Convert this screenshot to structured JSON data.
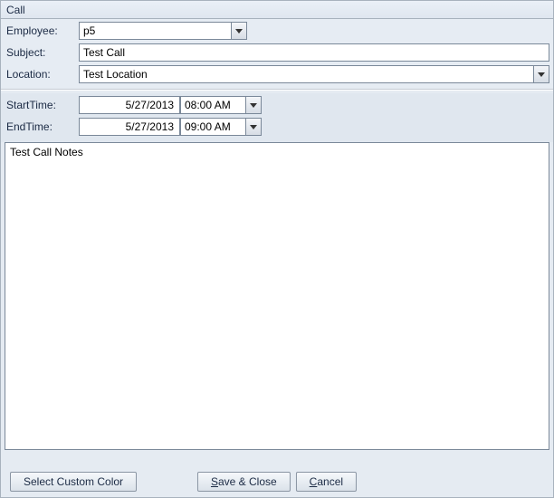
{
  "window": {
    "title": "Call"
  },
  "labels": {
    "employee": "Employee:",
    "subject": "Subject:",
    "location": "Location:",
    "start_time": "StartTime:",
    "end_time": "EndTime:"
  },
  "fields": {
    "employee": "p5",
    "subject": "Test Call",
    "location": "Test Location",
    "start_date": "5/27/2013",
    "start_time": "08:00 AM",
    "end_date": "5/27/2013",
    "end_time": "09:00 AM",
    "notes": "Test Call Notes"
  },
  "buttons": {
    "select_custom_color": "Select Custom Color",
    "save_close": "Save & Close",
    "cancel": "Cancel"
  }
}
